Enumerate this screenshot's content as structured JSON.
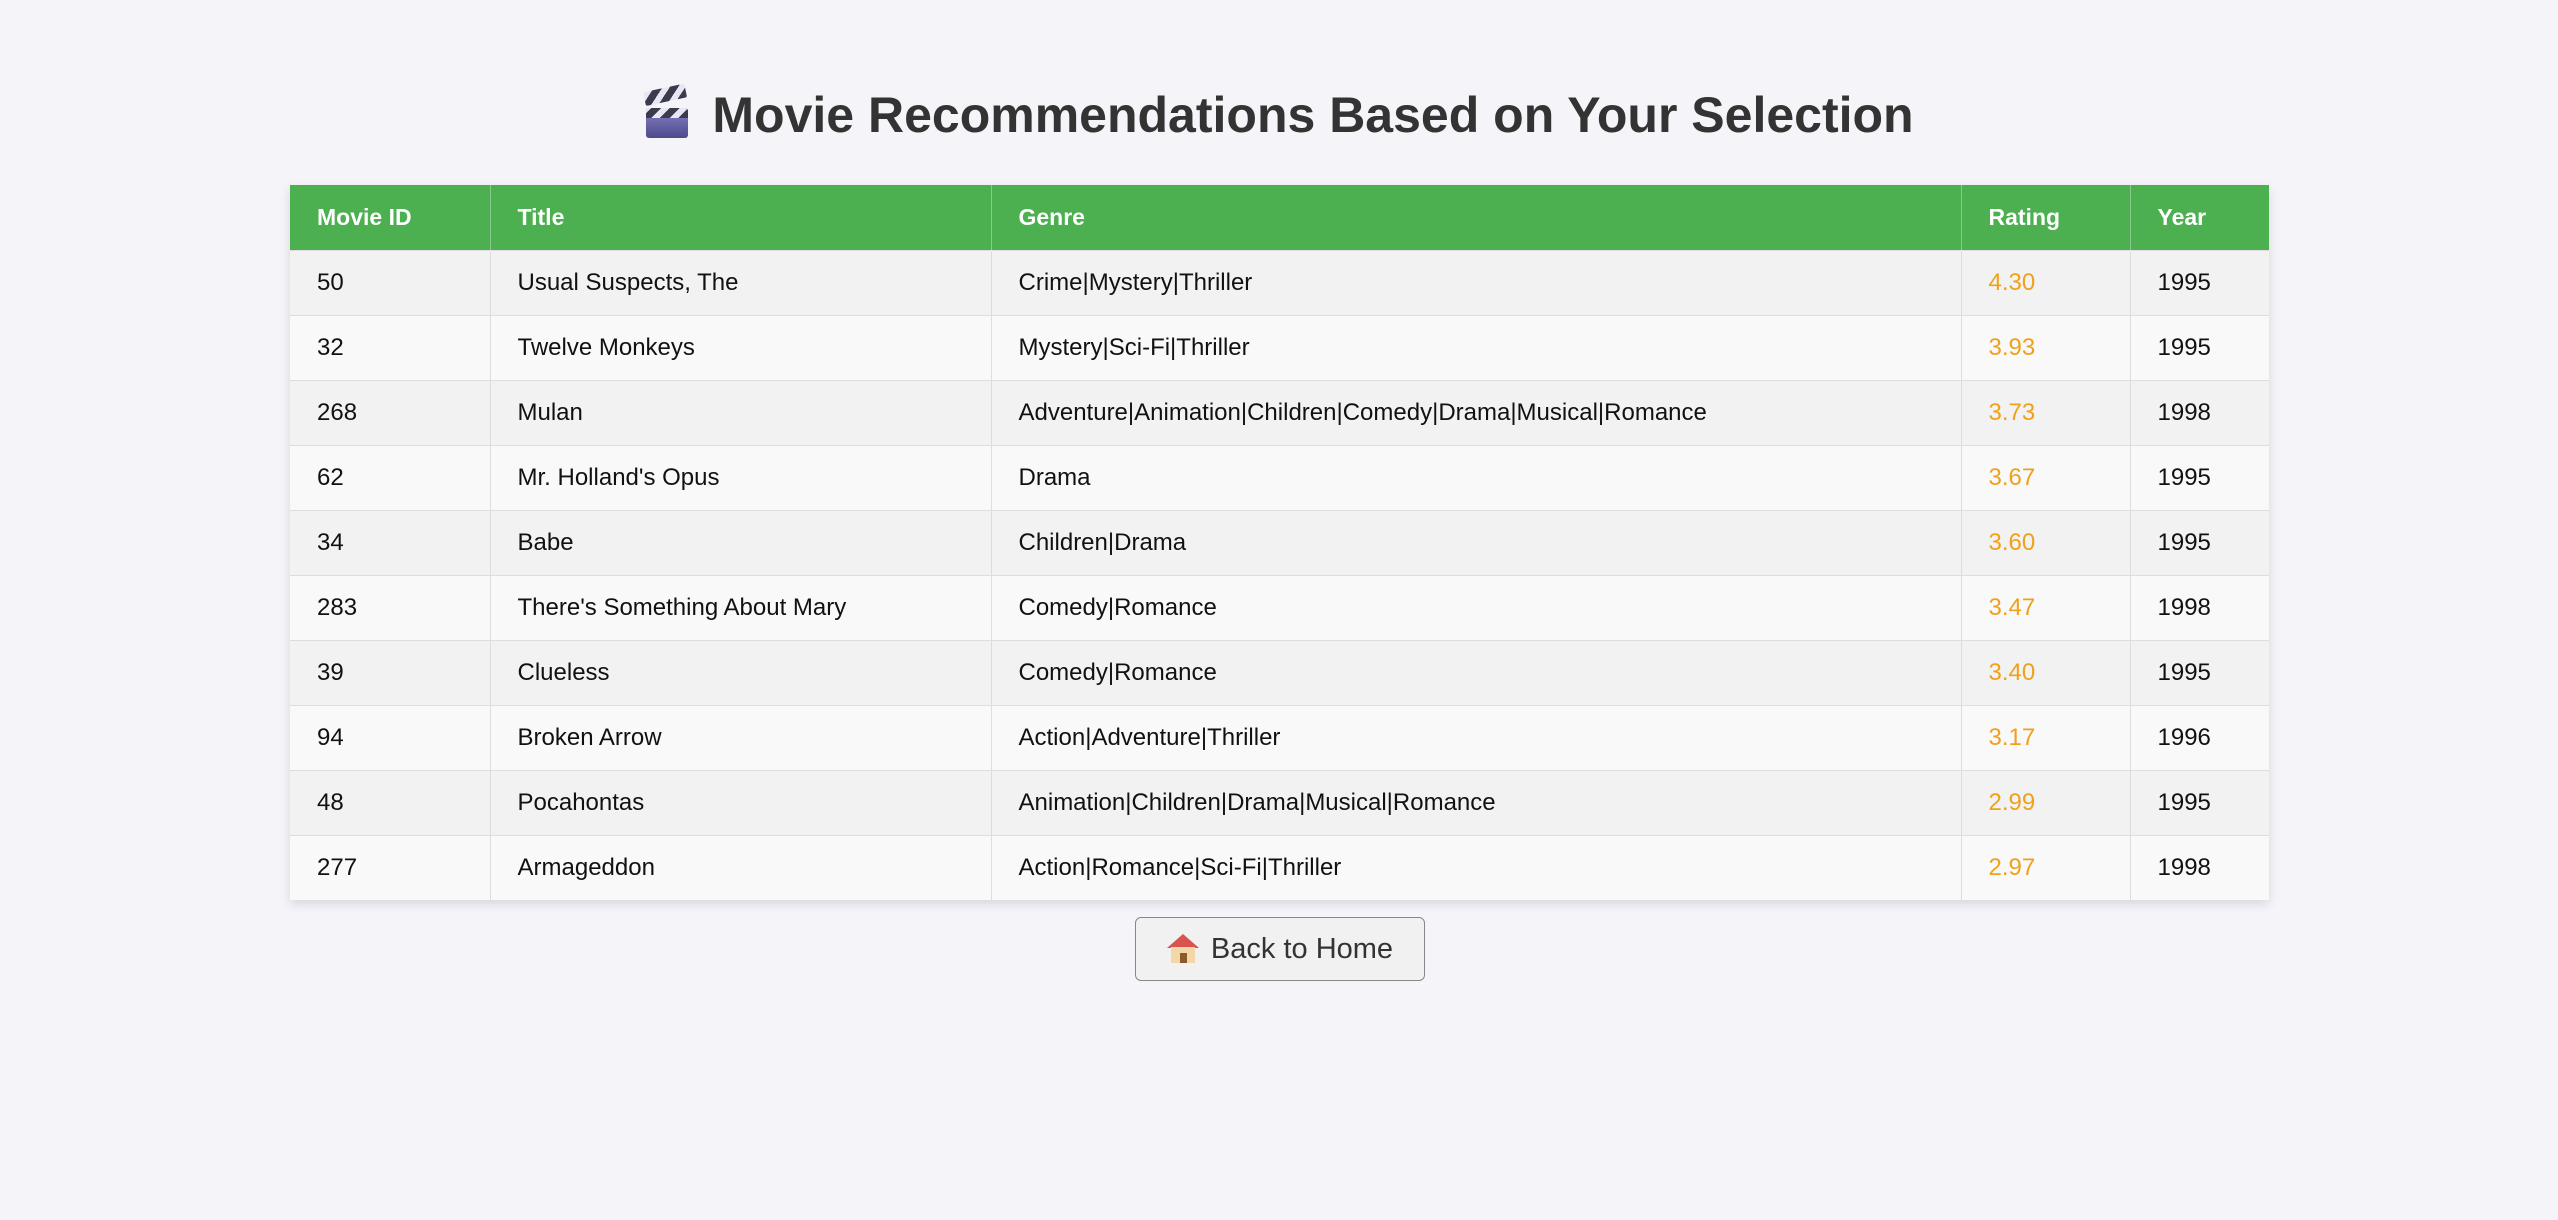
{
  "page": {
    "title": "Movie Recommendations Based on Your Selection",
    "title_icon": "clapper-board-icon"
  },
  "table": {
    "headers": [
      "Movie ID",
      "Title",
      "Genre",
      "Rating",
      "Year"
    ],
    "rows": [
      {
        "id": "50",
        "title": "Usual Suspects, The",
        "genre": "Crime|Mystery|Thriller",
        "rating": "4.30",
        "year": "1995"
      },
      {
        "id": "32",
        "title": "Twelve Monkeys",
        "genre": "Mystery|Sci-Fi|Thriller",
        "rating": "3.93",
        "year": "1995"
      },
      {
        "id": "268",
        "title": "Mulan",
        "genre": "Adventure|Animation|Children|Comedy|Drama|Musical|Romance",
        "rating": "3.73",
        "year": "1998"
      },
      {
        "id": "62",
        "title": "Mr. Holland's Opus",
        "genre": "Drama",
        "rating": "3.67",
        "year": "1995"
      },
      {
        "id": "34",
        "title": "Babe",
        "genre": "Children|Drama",
        "rating": "3.60",
        "year": "1995"
      },
      {
        "id": "283",
        "title": "There's Something About Mary",
        "genre": "Comedy|Romance",
        "rating": "3.47",
        "year": "1998"
      },
      {
        "id": "39",
        "title": "Clueless",
        "genre": "Comedy|Romance",
        "rating": "3.40",
        "year": "1995"
      },
      {
        "id": "94",
        "title": "Broken Arrow",
        "genre": "Action|Adventure|Thriller",
        "rating": "3.17",
        "year": "1996"
      },
      {
        "id": "48",
        "title": "Pocahontas",
        "genre": "Animation|Children|Drama|Musical|Romance",
        "rating": "2.99",
        "year": "1995"
      },
      {
        "id": "277",
        "title": "Armageddon",
        "genre": "Action|Romance|Sci-Fi|Thriller",
        "rating": "2.97",
        "year": "1998"
      }
    ]
  },
  "back_button": {
    "label": "Back to Home",
    "icon": "house-icon"
  },
  "colors": {
    "header_bg": "#4caf50",
    "rating_text": "#f0a11a",
    "page_bg": "#f4f4f9"
  }
}
